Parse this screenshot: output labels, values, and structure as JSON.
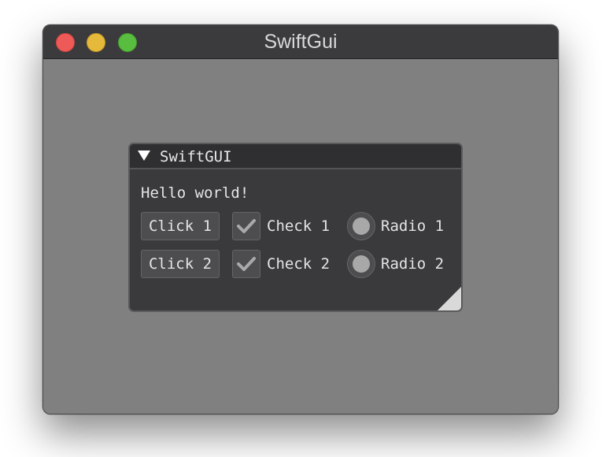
{
  "window": {
    "title": "SwiftGui",
    "background_color": "#808080",
    "traffic_lights": {
      "close_color": "#ee5a57",
      "minimize_color": "#e5b93a",
      "zoom_color": "#59bd3f"
    }
  },
  "panel": {
    "title": "SwiftGUI",
    "collapse_icon": "triangle-down-icon",
    "text": "Hello world!",
    "rows": [
      {
        "button_label": "Click 1",
        "checkbox_label": "Check 1",
        "checkbox_checked": true,
        "radio_label": "Radio 1"
      },
      {
        "button_label": "Click 2",
        "checkbox_label": "Check 2",
        "checkbox_checked": true,
        "radio_label": "Radio 2"
      }
    ],
    "resize_icon": "resize-grip-icon"
  }
}
